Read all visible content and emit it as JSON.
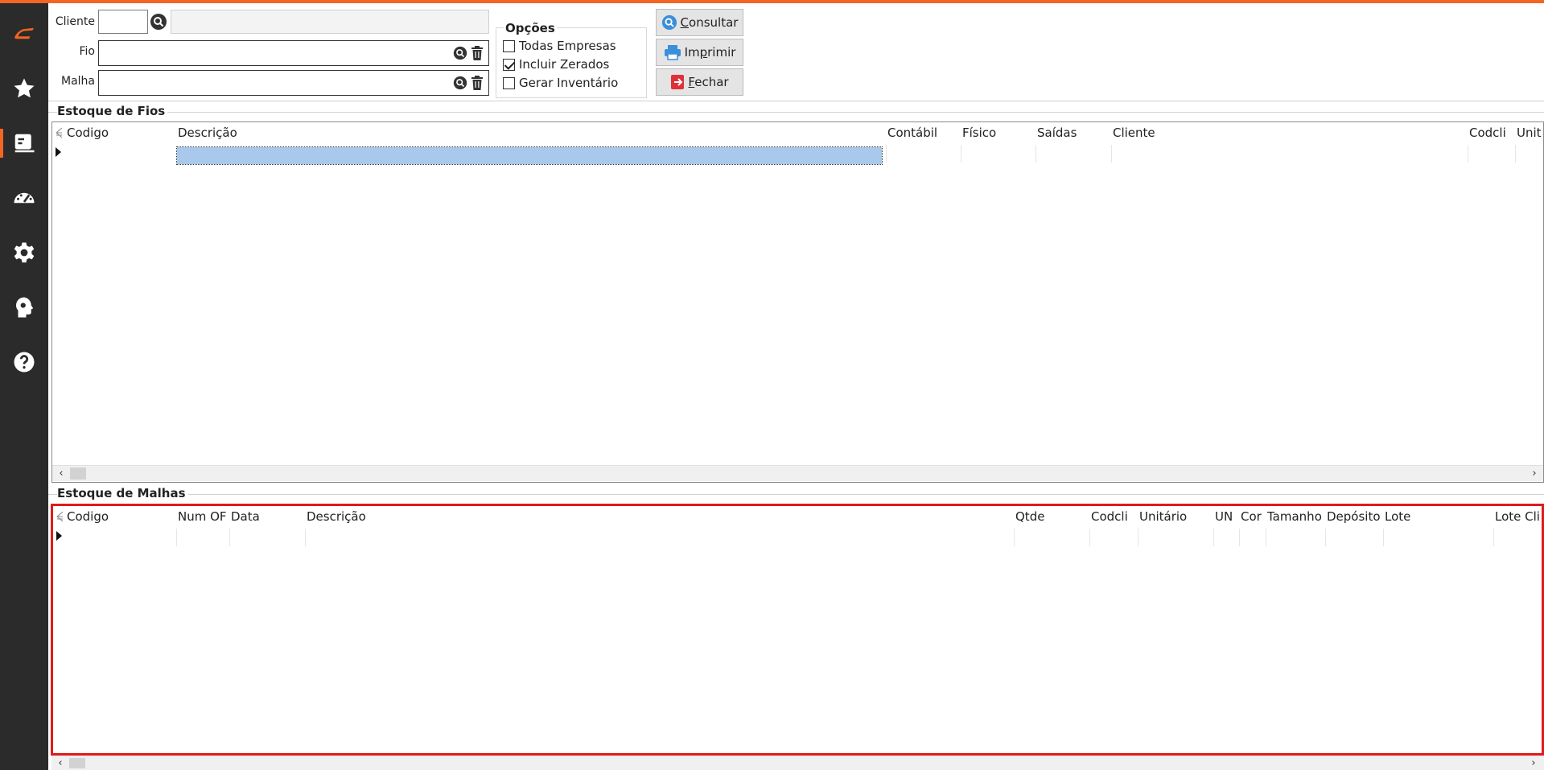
{
  "accent_color": "#f26522",
  "sidebar": {
    "items": [
      {
        "icon": "app-logo-icon"
      },
      {
        "icon": "star-icon"
      },
      {
        "icon": "report-icon",
        "active": true
      },
      {
        "icon": "dashboard-gauge-icon"
      },
      {
        "icon": "gear-icon"
      },
      {
        "icon": "settings-head-icon"
      },
      {
        "icon": "help-icon"
      }
    ]
  },
  "filters": {
    "cliente_label": "Cliente",
    "fio_label": "Fio",
    "malha_label": "Malha",
    "cliente_code": "",
    "cliente_name": "",
    "fio_value": "",
    "malha_value": ""
  },
  "options": {
    "title": "Opções",
    "items": [
      {
        "label": "Todas Empresas",
        "checked": false
      },
      {
        "label": "Incluir Zerados",
        "checked": true
      },
      {
        "label": "Gerar Inventário",
        "checked": false
      }
    ]
  },
  "buttons": {
    "consultar": {
      "accel": "C",
      "rest": "onsultar"
    },
    "imprimir": {
      "pre": "Im",
      "accel": "p",
      "rest": "rimir"
    },
    "fechar": {
      "accel": "F",
      "rest": "echar"
    }
  },
  "fios": {
    "title": "Estoque de Fios",
    "columns": [
      "Codigo",
      "Descrição",
      "Contábil",
      "Físico",
      "Saídas",
      "Cliente",
      "Codcli",
      "Unit"
    ]
  },
  "malhas": {
    "title": "Estoque de Malhas",
    "columns": [
      "Codigo",
      "Num OF",
      "Data",
      "Descrição",
      "Qtde",
      "Codcli",
      "Unitário",
      "UN",
      "Cor",
      "Tamanho",
      "Depósito",
      "Lote",
      "Lote Cli"
    ]
  }
}
